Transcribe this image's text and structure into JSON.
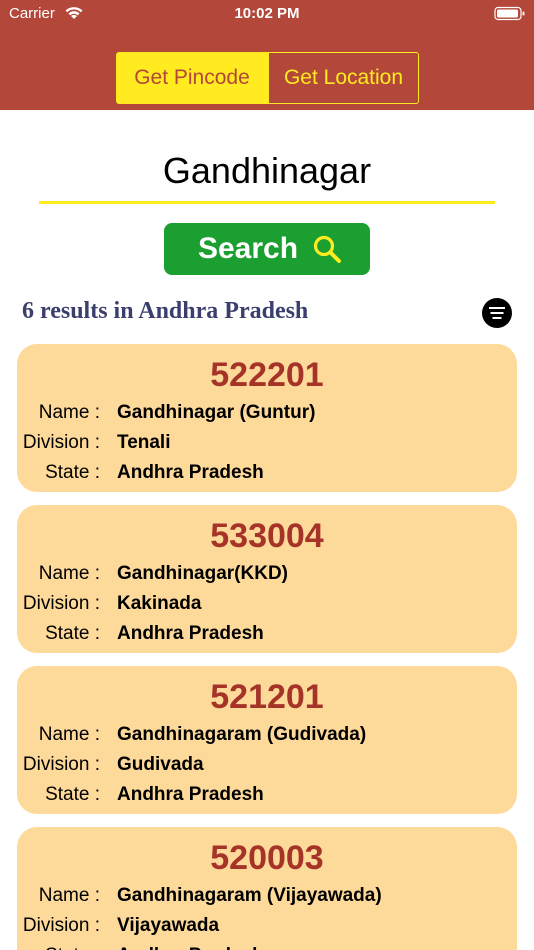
{
  "status_bar": {
    "carrier": "Carrier",
    "time": "10:02 PM"
  },
  "tabs": {
    "pincode_label": "Get Pincode",
    "location_label": "Get Location",
    "selected": "Get Pincode"
  },
  "search": {
    "value": "Gandhinagar",
    "button_label": "Search"
  },
  "results": {
    "title": "6 results in Andhra Pradesh",
    "labels": {
      "name": "Name :",
      "division": "Division :",
      "state": "State :"
    },
    "items": [
      {
        "pincode": "522201",
        "name": "Gandhinagar (Guntur)",
        "division": "Tenali",
        "state": "Andhra Pradesh"
      },
      {
        "pincode": "533004",
        "name": "Gandhinagar(KKD)",
        "division": "Kakinada",
        "state": "Andhra Pradesh"
      },
      {
        "pincode": "521201",
        "name": "Gandhinagaram (Gudivada)",
        "division": "Gudivada",
        "state": "Andhra Pradesh"
      },
      {
        "pincode": "520003",
        "name": "Gandhinagaram (Vijayawada)",
        "division": "Vijayawada",
        "state": "Andhra Pradesh"
      }
    ]
  },
  "colors": {
    "header": "#b3473a",
    "accent_yellow": "#ffeb1f",
    "search_green": "#1a9f30",
    "card": "#fdd99a",
    "pincode": "#a63328",
    "results_title": "#3b3f6e"
  }
}
